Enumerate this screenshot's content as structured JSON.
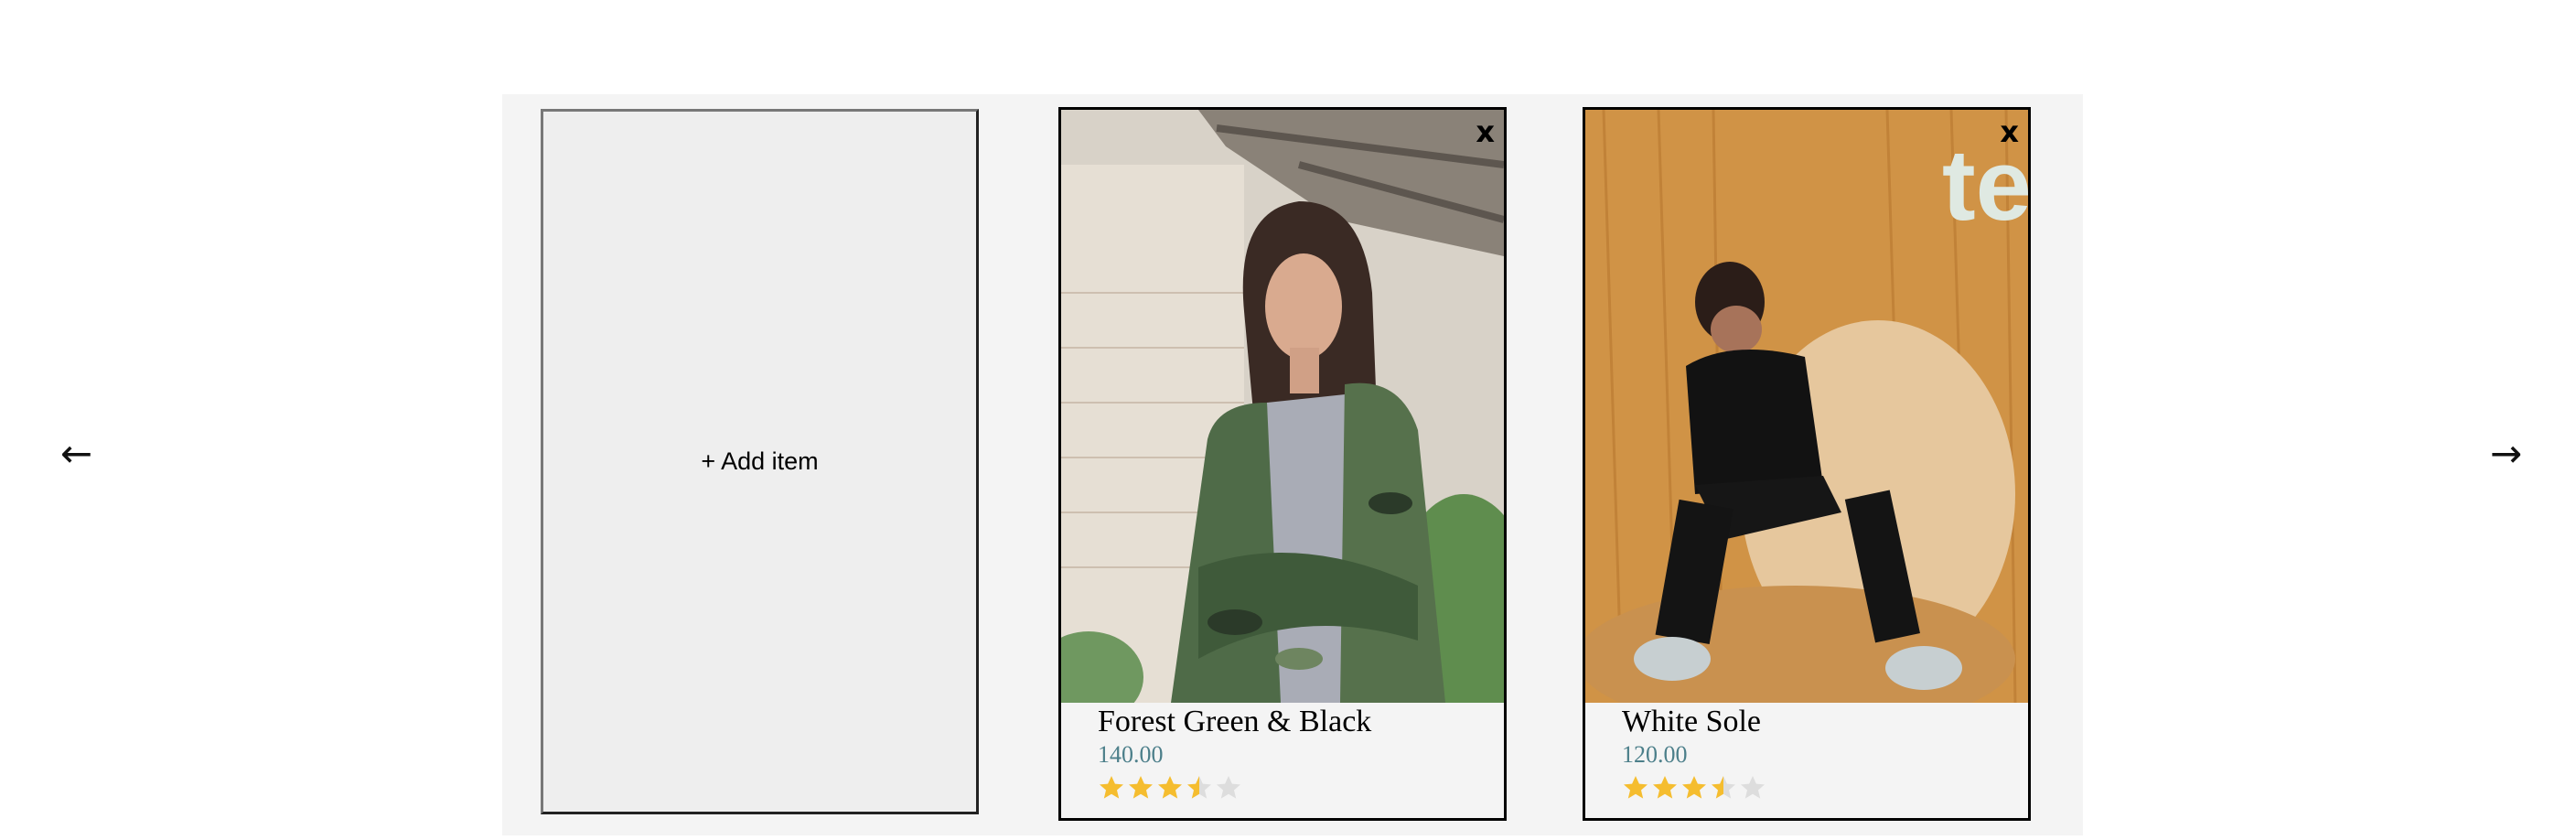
{
  "nav": {
    "prev_label": "←",
    "next_label": "→"
  },
  "add_item": {
    "label": "+ Add item"
  },
  "products": [
    {
      "name": "Forest Green & Black",
      "price": "140.00",
      "rating": 3.5,
      "rating_max": 5,
      "close_label": "x",
      "photo": "woman in camouflage jacket"
    },
    {
      "name": "White Sole",
      "price": "120.00",
      "rating": 3.5,
      "rating_max": 5,
      "close_label": "x",
      "photo": "man in black outfit on fur chair"
    }
  ],
  "colors": {
    "star_filled": "#f5bd2f",
    "star_empty": "#dddddd",
    "price": "#4c7f8a"
  }
}
